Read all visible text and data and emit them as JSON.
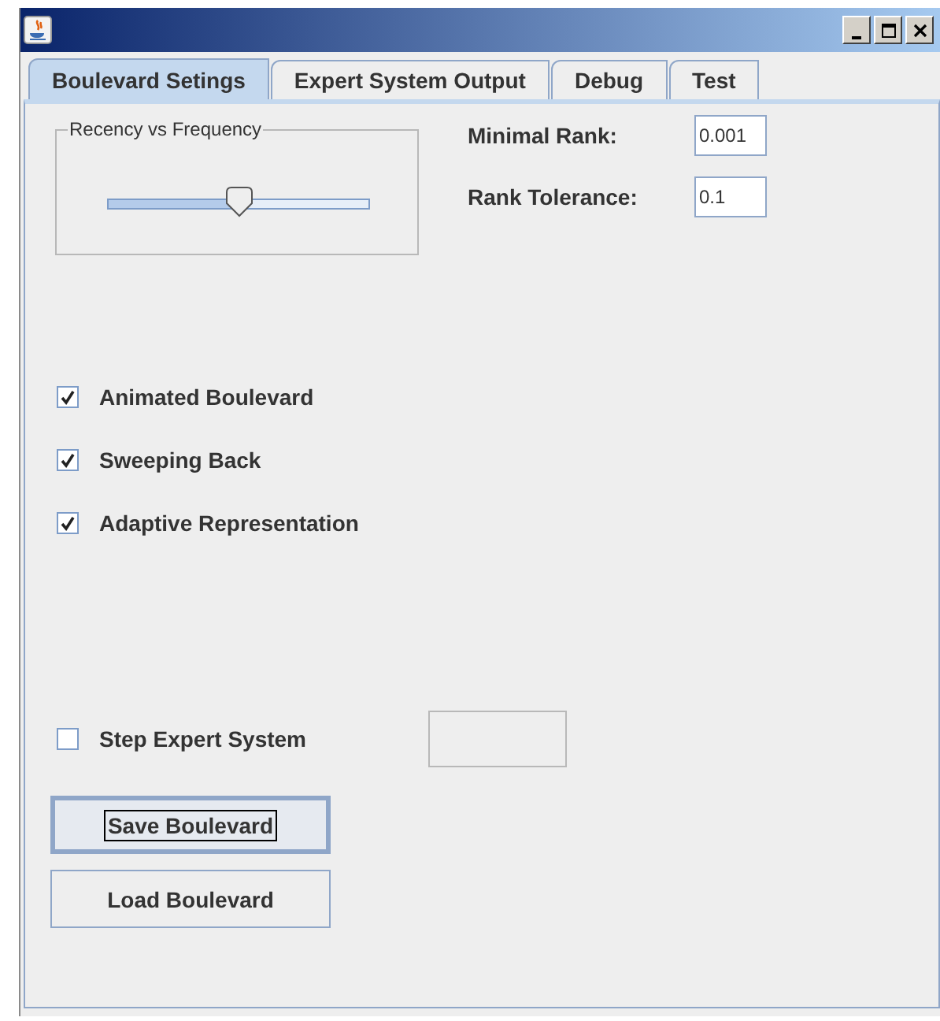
{
  "tabs": [
    {
      "label": "Boulevard Setings",
      "selected": true
    },
    {
      "label": "Expert System Output",
      "selected": false
    },
    {
      "label": "Debug",
      "selected": false
    },
    {
      "label": "Test",
      "selected": false
    }
  ],
  "slider_group": {
    "title": "Recency vs Frequency",
    "level": 0.5
  },
  "fields": [
    {
      "label": "Minimal Rank:",
      "value": "0.001"
    },
    {
      "label": "Rank Tolerance:",
      "value": "0.1"
    }
  ],
  "options": [
    {
      "label": "Animated Boulevard",
      "checked": true
    },
    {
      "label": "Sweeping Back",
      "checked": true
    },
    {
      "label": "Adaptive Representation",
      "checked": true
    }
  ],
  "step_expert_system": {
    "label": "Step Expert System",
    "checked": false
  },
  "buttons": [
    {
      "label": "Save Boulevard",
      "focused": true
    },
    {
      "label": "Load Boulevard",
      "focused": false
    }
  ]
}
